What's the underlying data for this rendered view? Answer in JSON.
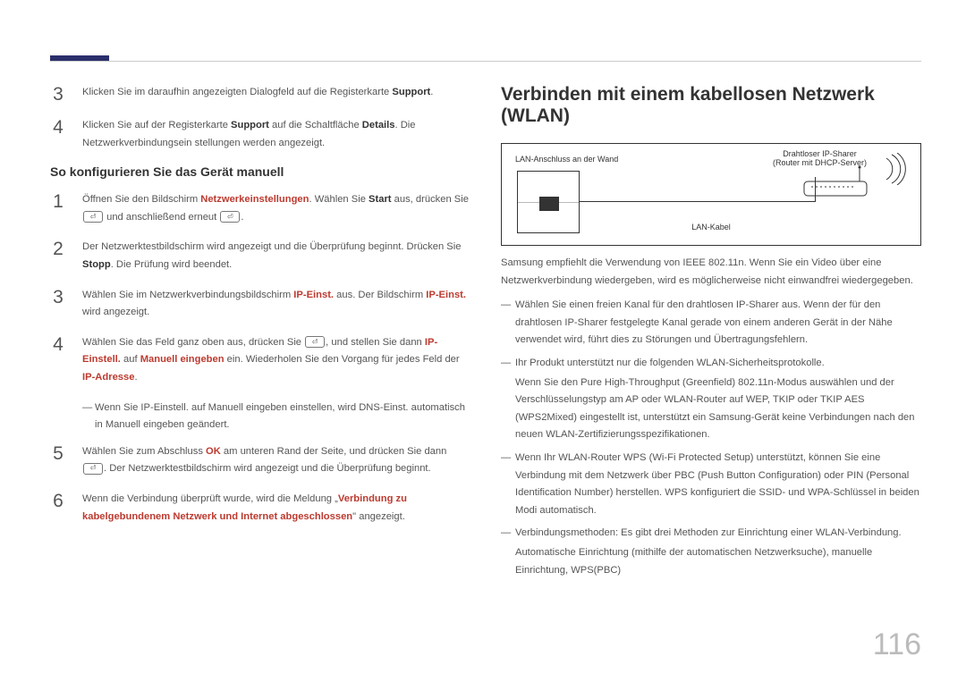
{
  "left": {
    "step3": {
      "pre": "Klicken Sie im daraufhin angezeigten Dialogfeld auf die Registerkarte ",
      "b1": "Support",
      "post": "."
    },
    "step4": {
      "pre": "Klicken Sie auf der Registerkarte ",
      "b1": "Support",
      "mid1": " auf die Schaltfläche ",
      "b2": "Details",
      "post": ". Die Netzwerkverbindungsein stellungen werden angezeigt."
    },
    "h3": "So konfigurieren Sie das Gerät manuell",
    "m1": {
      "pre": "Öffnen Sie den Bildschirm ",
      "r1": "Netzwerkeinstellungen",
      "mid": ". Wählen Sie ",
      "b1": "Start",
      "mid2": " aus, drücken Sie ",
      "post": " und anschließend erneut ",
      "post2": "."
    },
    "m2": {
      "pre": "Der Netzwerktestbildschirm wird angezeigt und die Überprüfung beginnt. Drücken Sie ",
      "b1": "Stopp",
      "post": ". Die Prüfung wird beendet."
    },
    "m3": {
      "pre": "Wählen Sie im Netzwerkverbindungsbildschirm ",
      "r1": "IP-Einst.",
      "mid": " aus. Der Bildschirm ",
      "r2": "IP-Einst.",
      "post": " wird angezeigt."
    },
    "m4": {
      "pre": "Wählen Sie das Feld ganz oben aus, drücken Sie ",
      "mid": ", und stellen Sie dann ",
      "r1": "IP-Einstell.",
      "mid2": " auf ",
      "r2": "Manuell eingeben",
      "mid3": " ein. Wiederholen Sie den Vorgang für jedes Feld der ",
      "r3": "IP-Adresse",
      "post": "."
    },
    "note": {
      "pre": "Wenn Sie ",
      "r1": "IP-Einstell.",
      "mid1": " auf ",
      "r2": "Manuell eingeben",
      "mid2": " einstellen, wird ",
      "r3": "DNS-Einst.",
      "mid3": " automatisch in ",
      "r4": "Manuell eingeben",
      "post": " geändert."
    },
    "m5": {
      "pre": "Wählen Sie zum Abschluss ",
      "r1": "OK",
      "mid": " am unteren Rand der Seite, und drücken Sie dann ",
      "post": ". Der Netzwerktestbildschirm wird angezeigt und die Überprüfung beginnt."
    },
    "m6": {
      "pre": "Wenn die Verbindung überprüft wurde, wird die Meldung „",
      "r1": "Verbindung zu kabelgebundenem Netzwerk und Internet abgeschlossen",
      "post": "\" angezeigt."
    }
  },
  "right": {
    "title": "Verbinden mit einem kabellosen Netzwerk (WLAN)",
    "dia": {
      "wall": "LAN-Anschluss an der Wand",
      "router": "Drahtloser IP-Sharer\n(Router mit DHCP-Server)",
      "cable": "LAN-Kabel"
    },
    "p1": "Samsung empfiehlt die Verwendung von IEEE 802.11n. Wenn Sie ein Video über eine Netzwerkverbindung wiedergeben, wird es möglicherweise nicht einwandfrei wiedergegeben.",
    "b1": "Wählen Sie einen freien Kanal für den drahtlosen IP-Sharer aus. Wenn der für den drahtlosen IP-Sharer festgelegte Kanal gerade von einem anderen Gerät in der Nähe verwendet wird, führt dies zu Störungen und Übertragungsfehlern.",
    "b2a": "Ihr Produkt unterstützt nur die folgenden WLAN-Sicherheitsprotokolle.",
    "b2b": "Wenn Sie den Pure High-Throughput (Greenfield) 802.11n-Modus auswählen und der Verschlüsselungstyp am AP oder WLAN-Router auf WEP, TKIP oder TKIP AES (WPS2Mixed) eingestellt ist, unterstützt ein Samsung-Gerät keine Verbindungen nach den neuen WLAN-Zertifizierungsspezifikationen.",
    "b3": "Wenn Ihr WLAN-Router WPS (Wi-Fi Protected Setup) unterstützt, können Sie eine Verbindung mit dem Netzwerk über PBC (Push Button Configuration) oder PIN (Personal Identification Number) herstellen. WPS konfiguriert die SSID- und WPA-Schlüssel in beiden Modi automatisch.",
    "b4a": "Verbindungsmethoden: Es gibt drei Methoden zur Einrichtung einer WLAN-Verbindung.",
    "b4b": "Automatische Einrichtung (mithilfe der automatischen Netzwerksuche), manuelle Einrichtung, ",
    "b4c": "WPS(PBC)"
  },
  "page": "116",
  "kbd": "⏎"
}
